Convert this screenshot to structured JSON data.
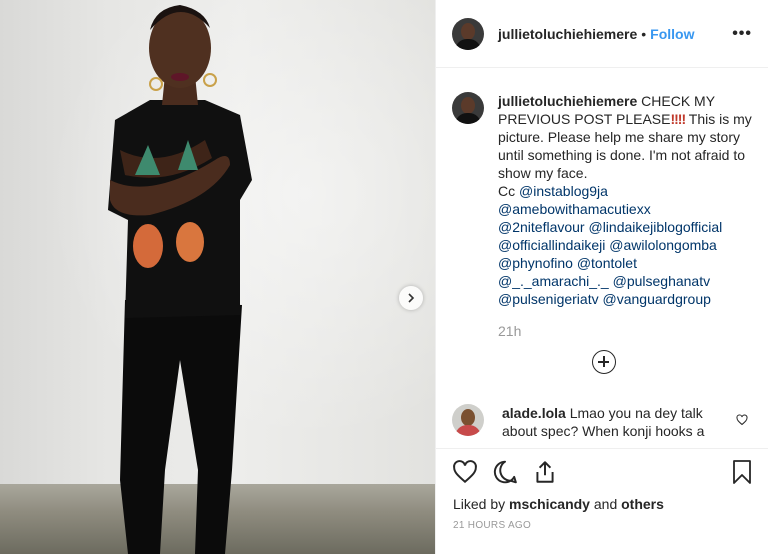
{
  "post": {
    "username": "jullietoluchiehiemere",
    "separator": "•",
    "follow_label": "Follow",
    "more_label": "•••"
  },
  "caption": {
    "username": "jullietoluchiehiemere",
    "text_before": "CHECK MY PREVIOUS POST PLEASE",
    "exclamations": "!!!!",
    "text_after": " This is my picture. Please help me share my story until something is done. I'm not afraid to show my face.",
    "cc_label": "Cc",
    "mentions": [
      "@instablog9ja",
      "@amebowithamacutiexx",
      "@2niteflavour",
      "@lindaikejiblogofficial",
      "@officiallindaikeji",
      "@awilolongomba",
      "@phynofino",
      "@tontolet",
      "@_._amarachi_._",
      "@pulseghanatv",
      "@pulsenigeriatv",
      "@vanguardgroup"
    ],
    "time": "21h"
  },
  "comment": {
    "username": "alade.lola",
    "text": "Lmao you na dey talk about spec? When konji hooks a"
  },
  "footer": {
    "liked_by_prefix": "Liked by",
    "liked_by_user": "mschicandy",
    "liked_by_and": "and",
    "liked_by_others": "others",
    "timestamp": "21 HOURS AGO"
  },
  "icons": {
    "like": "heart-icon",
    "comment": "comment-icon",
    "share": "share-icon",
    "save": "bookmark-icon",
    "next": "chevron-right-icon",
    "more": "more-options-icon",
    "load_more": "plus-circle-icon"
  },
  "colors": {
    "link": "#3897f0",
    "mention": "#003569",
    "secondary_text": "#999999",
    "text": "#262626"
  }
}
